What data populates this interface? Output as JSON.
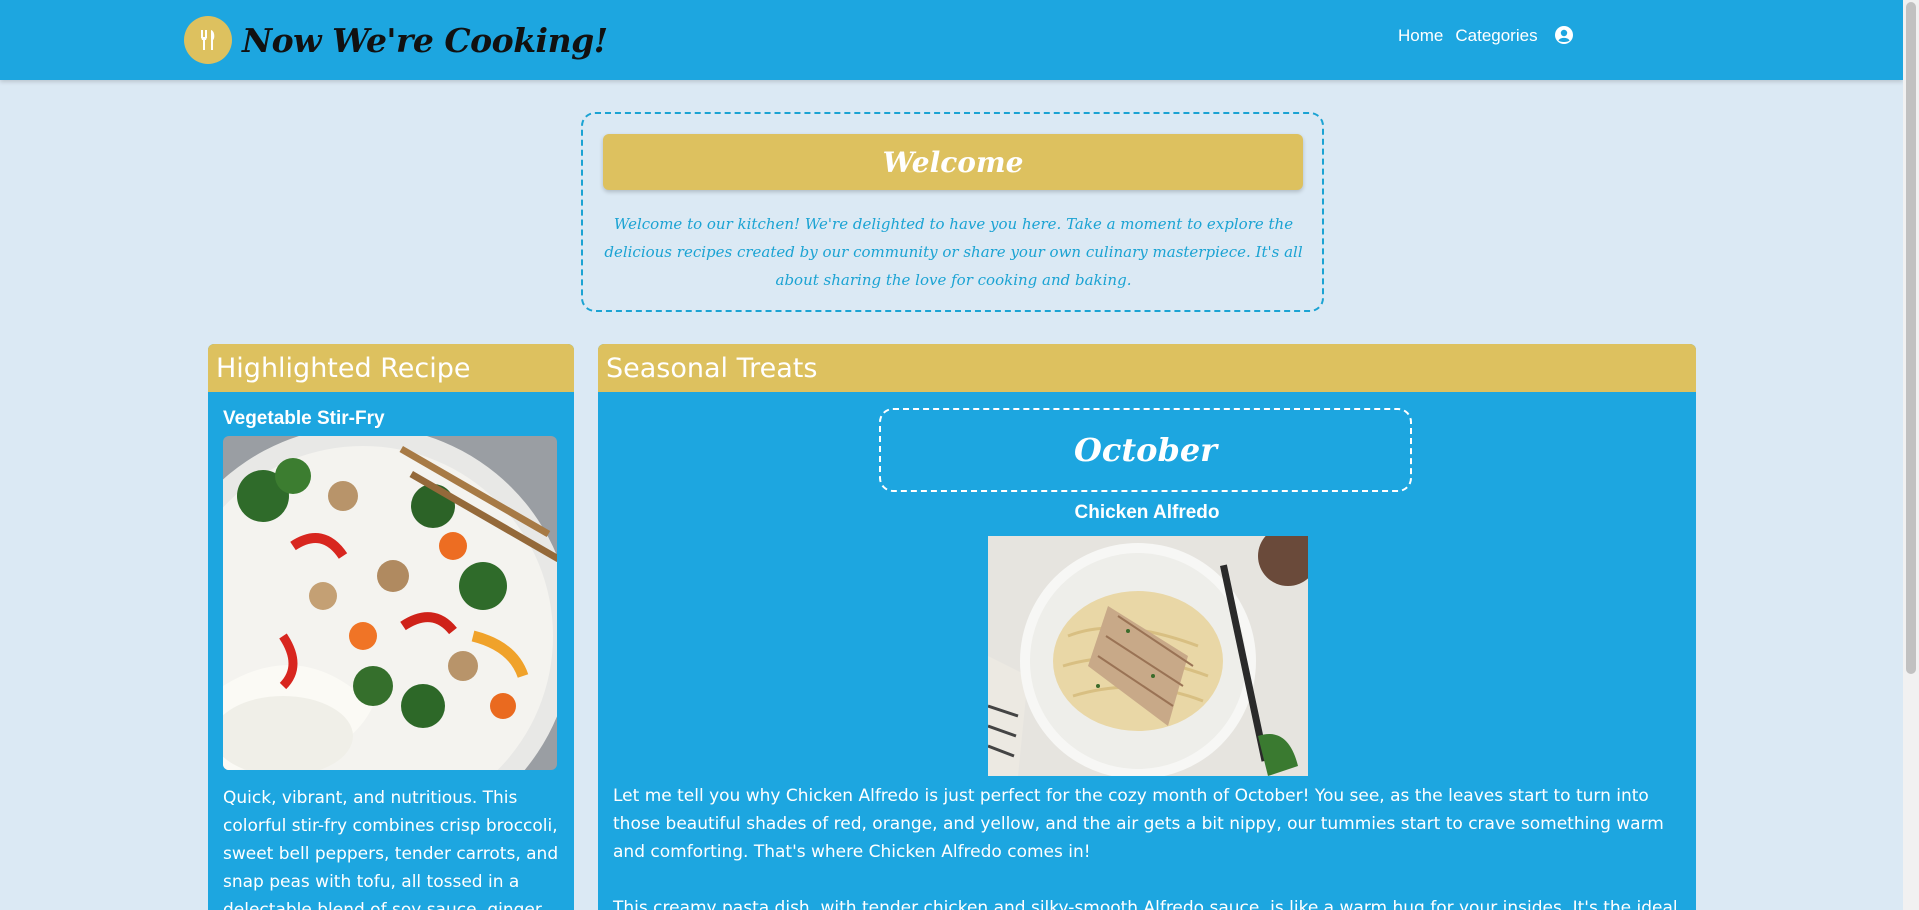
{
  "header": {
    "brand_title": "Now We're Cooking!",
    "logo_icon": "utensils-icon",
    "nav": [
      "Home",
      "Categories"
    ],
    "user_icon": "user-circle-icon"
  },
  "welcome": {
    "title": "Welcome",
    "text": "Welcome to our kitchen! We're delighted to have you here. Take a moment to explore the delicious recipes created by our community or share your own culinary masterpiece. It's all about sharing the love for cooking and baking."
  },
  "highlighted": {
    "heading": "Highlighted Recipe",
    "recipe_name": "Vegetable Stir-Fry",
    "description": "Quick, vibrant, and nutritious. This colorful stir-fry combines crisp broccoli, sweet bell peppers, tender carrots, and snap peas with tofu, all tossed in a delectable blend of soy sauce, ginger"
  },
  "seasonal": {
    "heading": "Seasonal Treats",
    "month": "October",
    "recipe_name": "Chicken Alfredo",
    "paragraph1": "Let me tell you why Chicken Alfredo is just perfect for the cozy month of October! You see, as the leaves start to turn into those beautiful shades of red, orange, and yellow, and the air gets a bit nippy, our tummies start to crave something warm and comforting. That's where Chicken Alfredo comes in!",
    "paragraph2": "This creamy pasta dish, with tender chicken and silky-smooth Alfredo sauce, is like a warm hug for your insides. It's the ideal"
  },
  "colors": {
    "primary": "#1da6e0",
    "accent": "#ddc15f",
    "background": "#dbe9f4"
  }
}
